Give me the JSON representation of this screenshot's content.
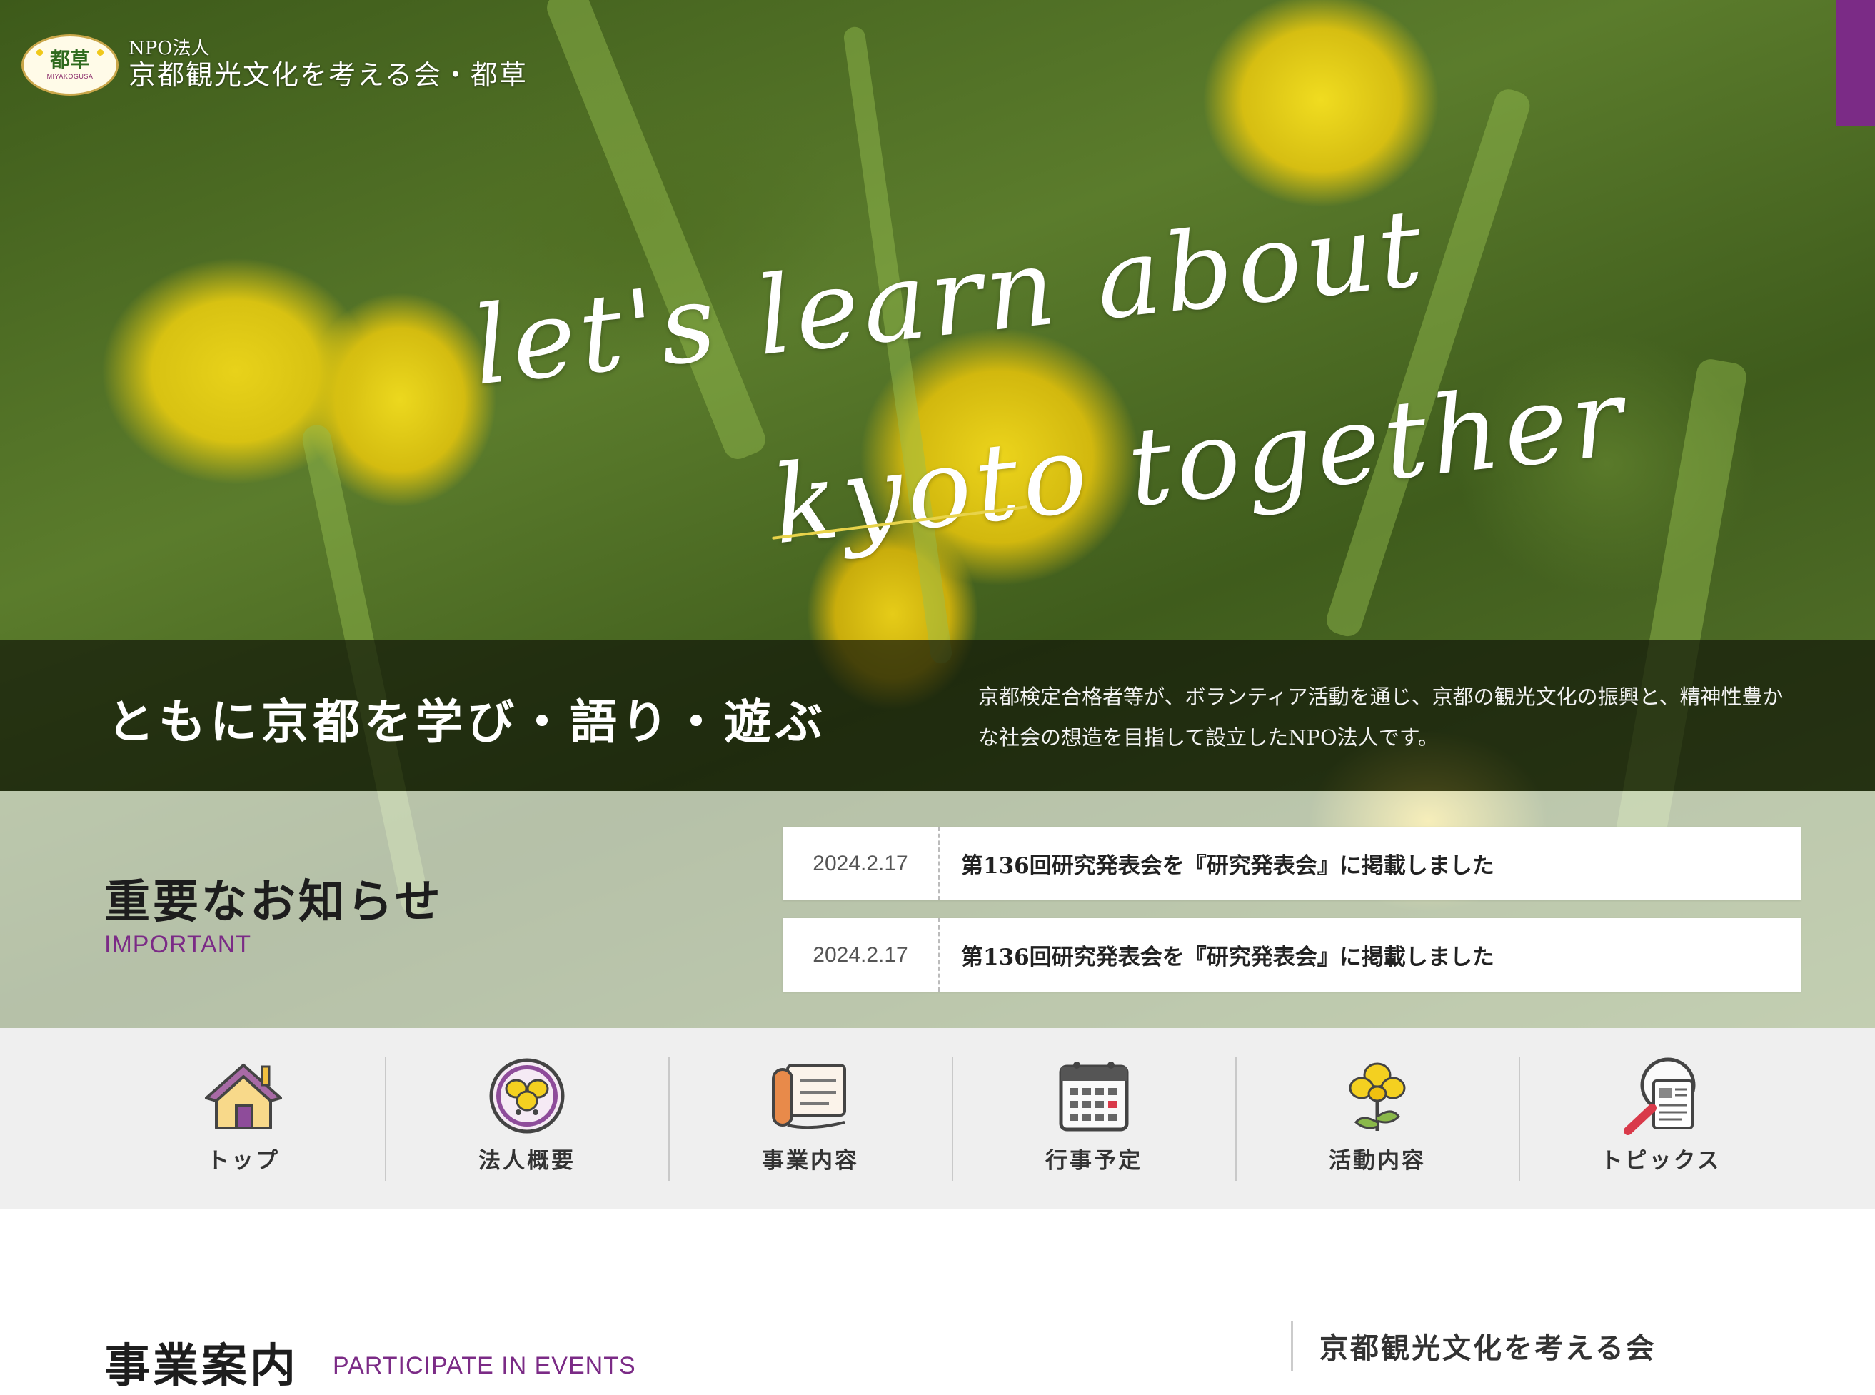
{
  "header": {
    "logo_kanji": "都草",
    "logo_latin": "MIYAKOGUSA",
    "org_type": "NPO法人",
    "org_name": "京都観光文化を考える会・都草"
  },
  "hero": {
    "script_line1": "let's learn about",
    "script_line2": "kyoto together",
    "tagline": "ともに京都を学び・語り・遊ぶ",
    "description": "京都検定合格者等が、ボランティア活動を通じ、京都の観光文化の振興と、精神性豊かな社会の想造を目指して設立したNPO法人です。"
  },
  "important": {
    "title": "重要なお知らせ",
    "subtitle": "IMPORTANT",
    "items": [
      {
        "date": "2024.2.17",
        "title": "第136回研究発表会を『研究発表会』に掲載しました"
      },
      {
        "date": "2024.2.17",
        "title": "第136回研究発表会を『研究発表会』に掲載しました"
      }
    ]
  },
  "nav": {
    "items": [
      {
        "label": "トップ",
        "icon": "house-icon"
      },
      {
        "label": "法人概要",
        "icon": "flower-badge-icon"
      },
      {
        "label": "事業内容",
        "icon": "scroll-icon"
      },
      {
        "label": "行事予定",
        "icon": "calendar-icon"
      },
      {
        "label": "活動内容",
        "icon": "flower-icon"
      },
      {
        "label": "トピックス",
        "icon": "news-magnifier-icon"
      }
    ]
  },
  "events": {
    "title": "事業案内",
    "subtitle": "PARTICIPATE IN EVENTS"
  },
  "sidebar": {
    "title": "京都観光文化を考える会"
  },
  "colors": {
    "accent": "#7b2b86",
    "nav_background": "#efefef"
  }
}
